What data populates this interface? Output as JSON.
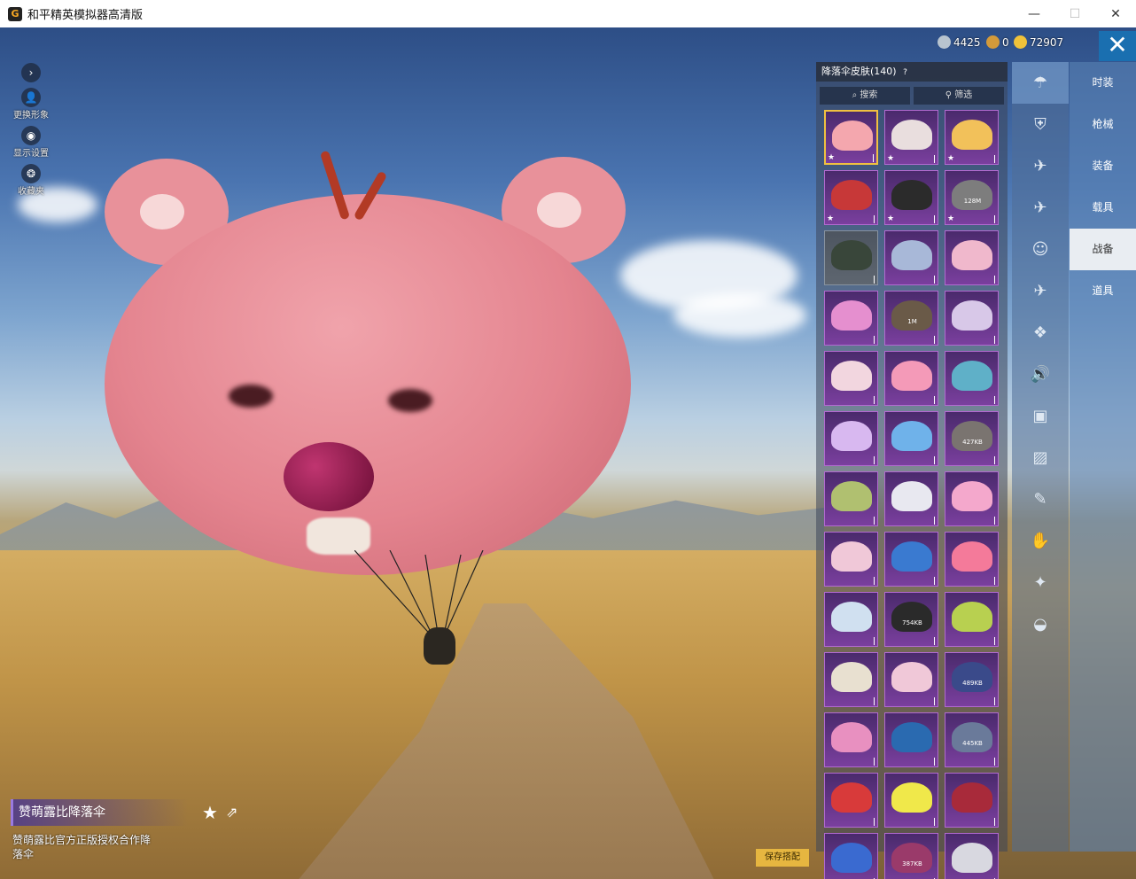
{
  "window": {
    "title": "和平精英模拟器高清版",
    "controls": [
      "—",
      "☐",
      "✕"
    ]
  },
  "left_tools": [
    {
      "icon": "chevron-right-icon",
      "label": "",
      "glyph": "›"
    },
    {
      "icon": "person-icon",
      "label": "更换形象",
      "glyph": "👤"
    },
    {
      "icon": "eye-icon",
      "label": "显示设置",
      "glyph": "◉"
    },
    {
      "icon": "collection-icon",
      "label": "收藏夹",
      "glyph": "❂"
    }
  ],
  "currency": [
    {
      "icon": "silver-coin-icon",
      "value": "4425",
      "color": "#b8c4cf"
    },
    {
      "icon": "bronze-coin-icon",
      "value": "0",
      "color": "#d49a3a"
    },
    {
      "icon": "gold-coin-icon",
      "value": "72907",
      "color": "#f0c23a"
    }
  ],
  "close_glyph": "✕",
  "panel": {
    "title": "降落伞皮肤(140)",
    "help_glyph": "?",
    "search_label": "搜索",
    "filter_label": "筛选",
    "tiles": [
      {
        "color": "#f4a7ae",
        "selected": true,
        "star": true
      },
      {
        "color": "#e9dede",
        "star": true
      },
      {
        "color": "#f2c15a",
        "star": true
      },
      {
        "color": "#c73838",
        "star": true
      },
      {
        "color": "#2b2b2b",
        "star": true
      },
      {
        "color": "#7d7d7d",
        "size": "128M",
        "star": true
      },
      {
        "color": "#39463a",
        "plain": true
      },
      {
        "color": "#a8b8d8"
      },
      {
        "color": "#f0b8cc"
      },
      {
        "color": "#e58fcf"
      },
      {
        "color": "#6a5a48",
        "size": "1M"
      },
      {
        "color": "#d8c8e8"
      },
      {
        "color": "#f2d6df"
      },
      {
        "color": "#f49ab8"
      },
      {
        "color": "#5fb0c8"
      },
      {
        "color": "#d8b8f0"
      },
      {
        "color": "#6fb2ea"
      },
      {
        "color": "#7a7470",
        "size": "427KB"
      },
      {
        "color": "#b0c070"
      },
      {
        "color": "#e8e8f0"
      },
      {
        "color": "#f4a8cc"
      },
      {
        "color": "#f0c8d8"
      },
      {
        "color": "#3a7ad0"
      },
      {
        "color": "#f47a9a"
      },
      {
        "color": "#d0e0f0"
      },
      {
        "color": "#2a2a2a",
        "size": "754KB"
      },
      {
        "color": "#b8d050"
      },
      {
        "color": "#e8e0d0"
      },
      {
        "color": "#f0c8d8"
      },
      {
        "color": "#3a4a8a",
        "size": "489KB"
      },
      {
        "color": "#e890c0"
      },
      {
        "color": "#2a6ab0"
      },
      {
        "color": "#6a7a9a",
        "size": "445KB"
      },
      {
        "color": "#d83a3a"
      },
      {
        "color": "#f0e84a"
      },
      {
        "color": "#a82a3a"
      },
      {
        "color": "#3a6ad0"
      },
      {
        "color": "#9a3a6a",
        "size": "387KB"
      },
      {
        "color": "#d8d8e0"
      }
    ]
  },
  "icon_bar": [
    {
      "icon": "parachute-icon",
      "glyph": "☂",
      "active": true
    },
    {
      "icon": "backpack-icon",
      "glyph": "⛨"
    },
    {
      "icon": "glider-icon",
      "glyph": "✈"
    },
    {
      "icon": "plane-icon",
      "glyph": "✈"
    },
    {
      "icon": "emote-icon",
      "glyph": "☺"
    },
    {
      "icon": "drone-icon",
      "glyph": "✈"
    },
    {
      "icon": "pet-icon",
      "glyph": "❖"
    },
    {
      "icon": "voice-icon",
      "glyph": "🔊"
    },
    {
      "icon": "chat-icon",
      "glyph": "▣"
    },
    {
      "icon": "photo-icon",
      "glyph": "▨"
    },
    {
      "icon": "spray-icon",
      "glyph": "✎"
    },
    {
      "icon": "hand-icon",
      "glyph": "✋"
    },
    {
      "icon": "effect-icon",
      "glyph": "✦"
    },
    {
      "icon": "ufo-icon",
      "glyph": "◒"
    }
  ],
  "categories": [
    {
      "label": "时装"
    },
    {
      "label": "枪械"
    },
    {
      "label": "装备"
    },
    {
      "label": "载具"
    },
    {
      "label": "战备",
      "active": true
    },
    {
      "label": "道具"
    }
  ],
  "item": {
    "name": "赞萌露比降落伞",
    "description": "赞萌露比官方正版授权合作降落伞",
    "star_glyph": "★",
    "share_glyph": "⇗"
  },
  "save_label": "保存搭配"
}
